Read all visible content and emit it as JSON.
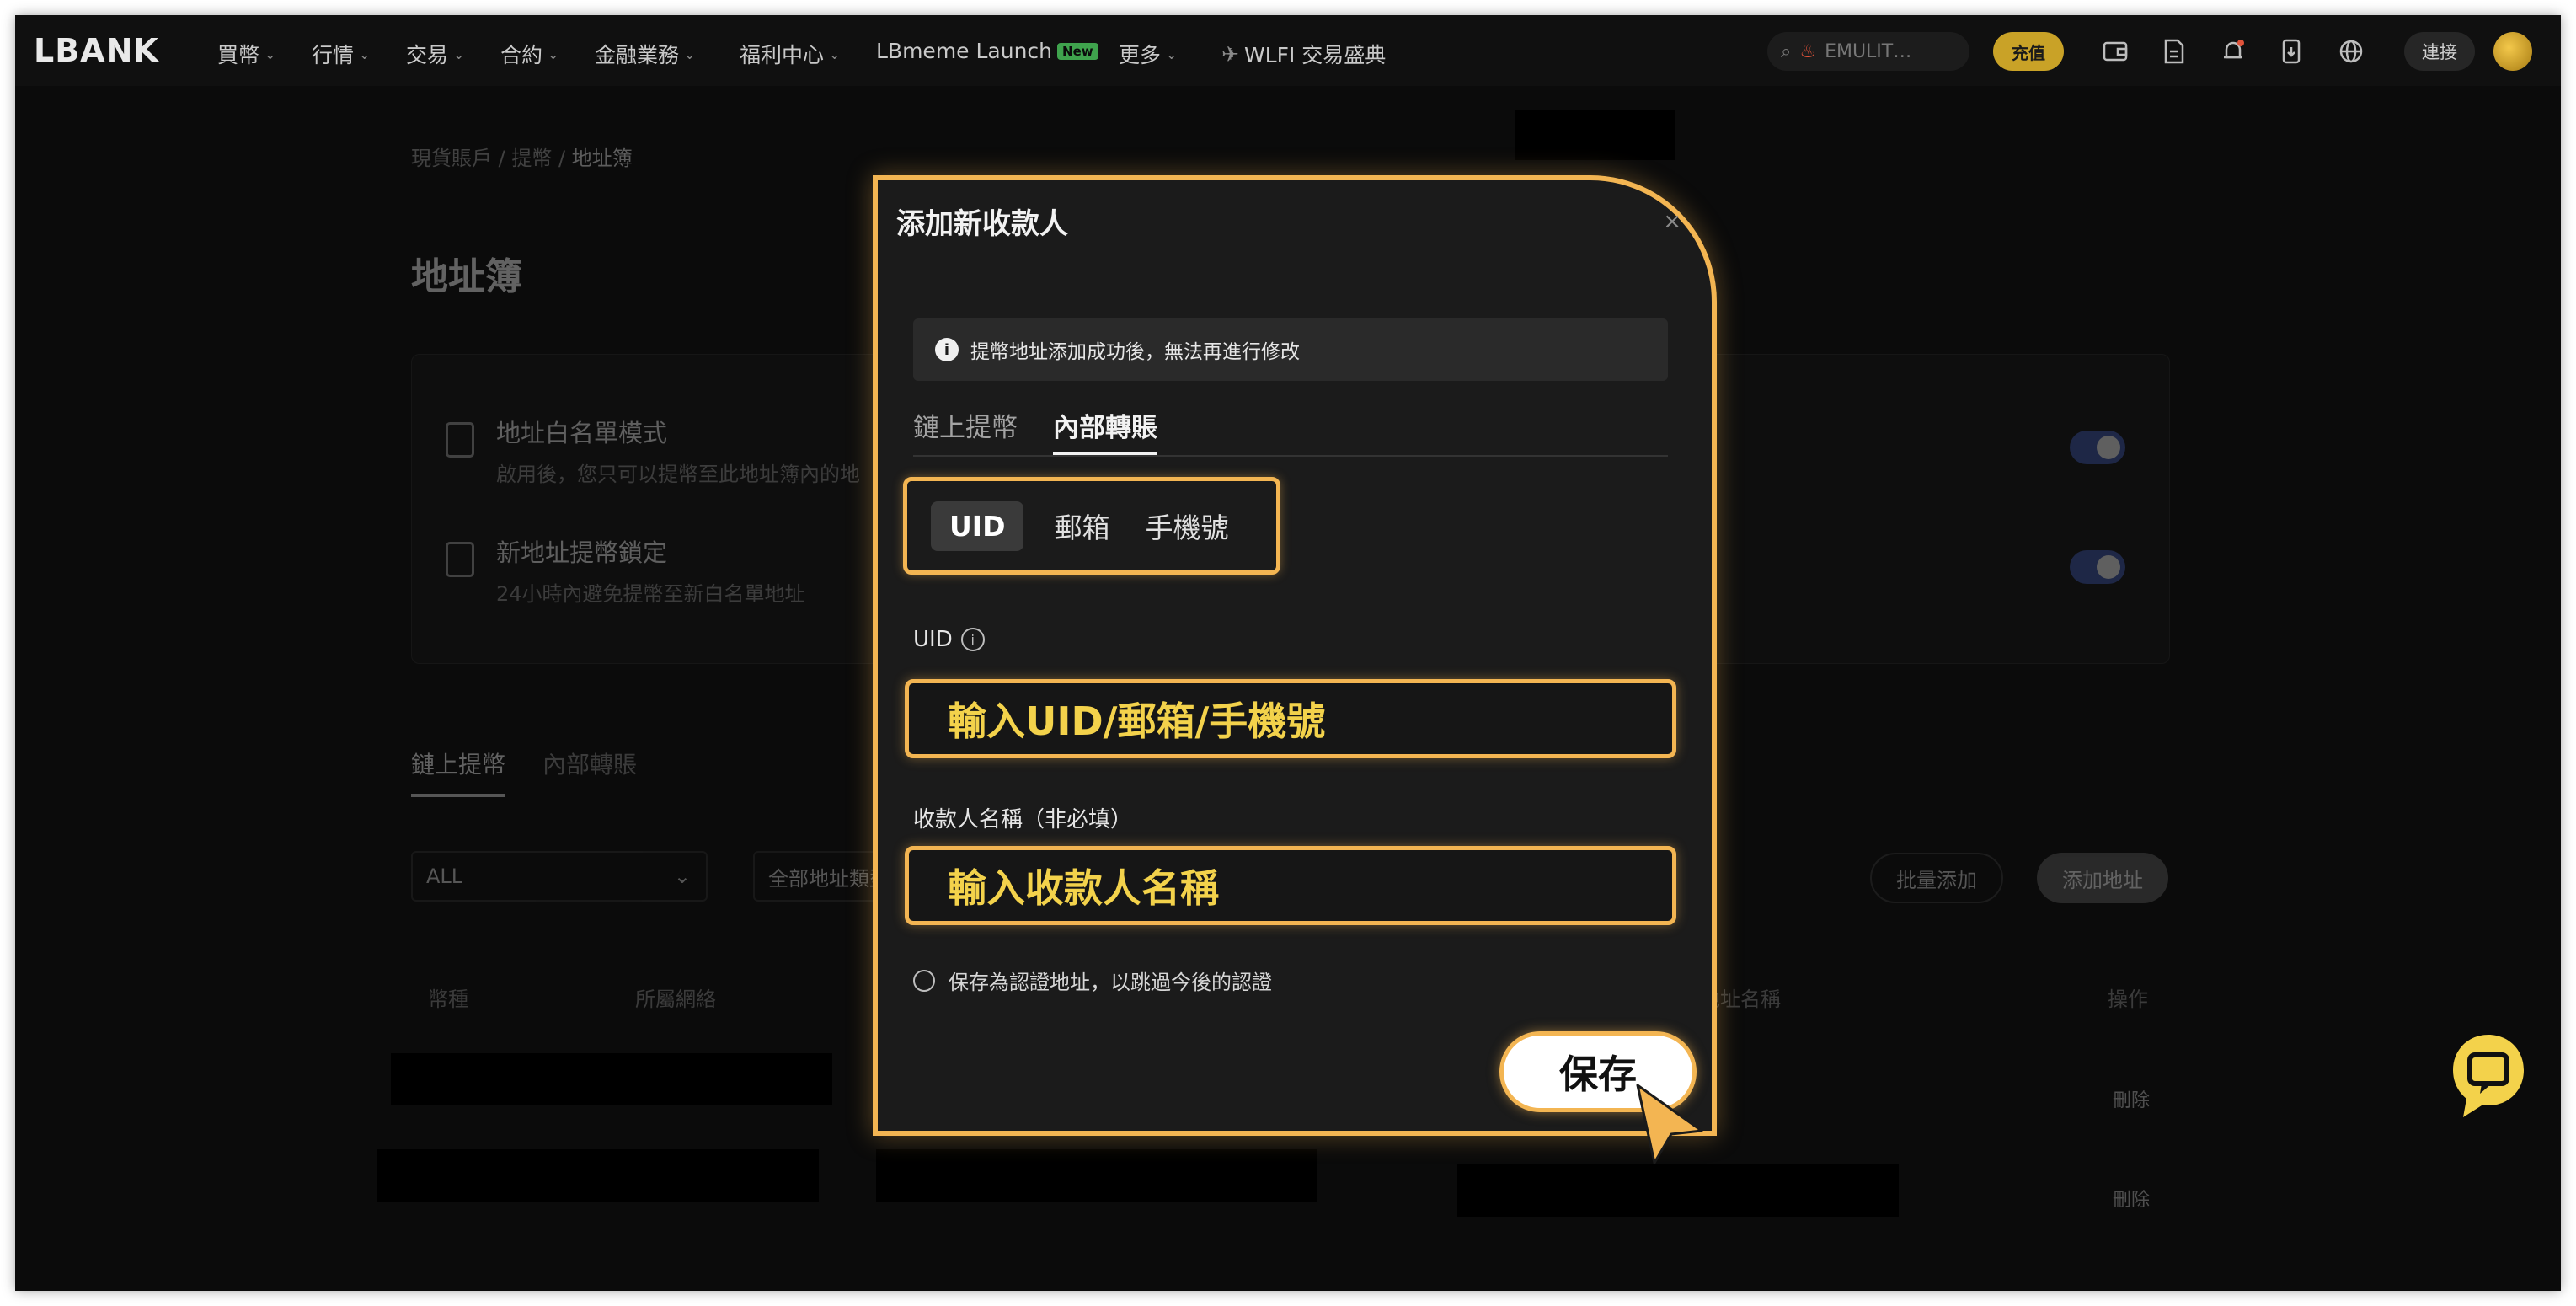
{
  "nav": {
    "logo": "LBANK",
    "items": [
      {
        "label": "買幣"
      },
      {
        "label": "行情"
      },
      {
        "label": "交易"
      },
      {
        "label": "合約"
      },
      {
        "label": "金融業務"
      },
      {
        "label": "福利中心"
      },
      {
        "label": "LBmeme Launch",
        "badge": "New"
      },
      {
        "label": "更多"
      },
      {
        "label": "WLFI 交易盛典"
      }
    ],
    "search_placeholder": "EMULIT…",
    "deposit_label": "充值",
    "connect_label": "連接",
    "icons": [
      "wallet-icon",
      "document-icon",
      "bell-icon",
      "download-icon",
      "globe-icon"
    ]
  },
  "page": {
    "breadcrumb": {
      "part1": "現貨賬戶",
      "sep": "/",
      "part2": "提幣",
      "current": "地址簿"
    },
    "title": "地址簿",
    "settings": [
      {
        "title": "地址白名單模式",
        "desc": "啟用後，您只可以提幣至此地址簿內的地"
      },
      {
        "title": "新地址提幣鎖定",
        "desc": "24小時內避免提幣至新白名單地址"
      }
    ],
    "tabs": [
      "鏈上提幣",
      "內部轉賬"
    ],
    "filter_coin": "ALL",
    "filter_type": "全部地址類型",
    "batch_add_label": "批量添加",
    "add_address_label": "添加地址",
    "table_headers": [
      "幣種",
      "所屬網絡",
      "地址名稱",
      "操作"
    ],
    "delete_label": "刪除"
  },
  "modal": {
    "title": "添加新收款人",
    "close": "×",
    "info": "提幣地址添加成功後，無法再進行修改",
    "tabs": [
      "鏈上提幣",
      "內部轉賬"
    ],
    "segments": [
      "UID",
      "郵箱",
      "手機號"
    ],
    "uid_label": "UID",
    "uid_placeholder": "輸入UID/郵箱/手機號",
    "name_label": "收款人名稱（非必填）",
    "name_placeholder": "輸入收款人名稱",
    "save_verified": "保存為認證地址，以跳過今後的認證",
    "save_label": "保存"
  },
  "colors": {
    "highlight": "#f3b552",
    "placeholder_text": "#f3d24b",
    "toggle_on": "#3d55a6",
    "chat_widget": "#f3d24b"
  }
}
